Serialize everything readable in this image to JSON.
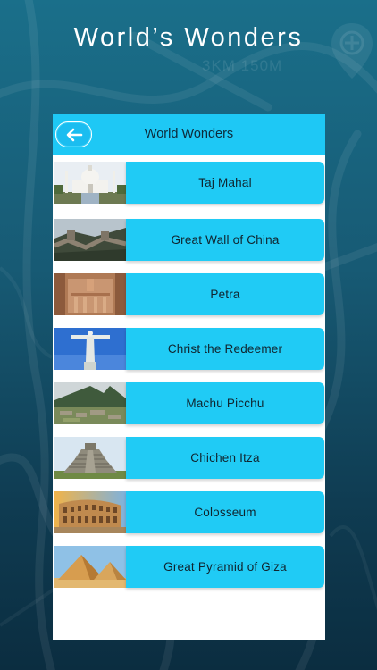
{
  "promo": {
    "title": "World’s Wonders",
    "map_distance": "3KM 150M"
  },
  "app": {
    "header_title": "World Wonders",
    "back_icon": "arrow-left-icon"
  },
  "wonders": [
    {
      "label": "Taj Mahal"
    },
    {
      "label": "Great Wall of China"
    },
    {
      "label": "Petra"
    },
    {
      "label": "Christ the Redeemer"
    },
    {
      "label": "Machu Picchu"
    },
    {
      "label": "Chichen Itza"
    },
    {
      "label": "Colosseum"
    },
    {
      "label": "Great Pyramid of Giza"
    }
  ],
  "colors": {
    "accent": "#1ec8f5",
    "background_top": "#1a6f8a",
    "background_bottom": "#0b2d40"
  }
}
